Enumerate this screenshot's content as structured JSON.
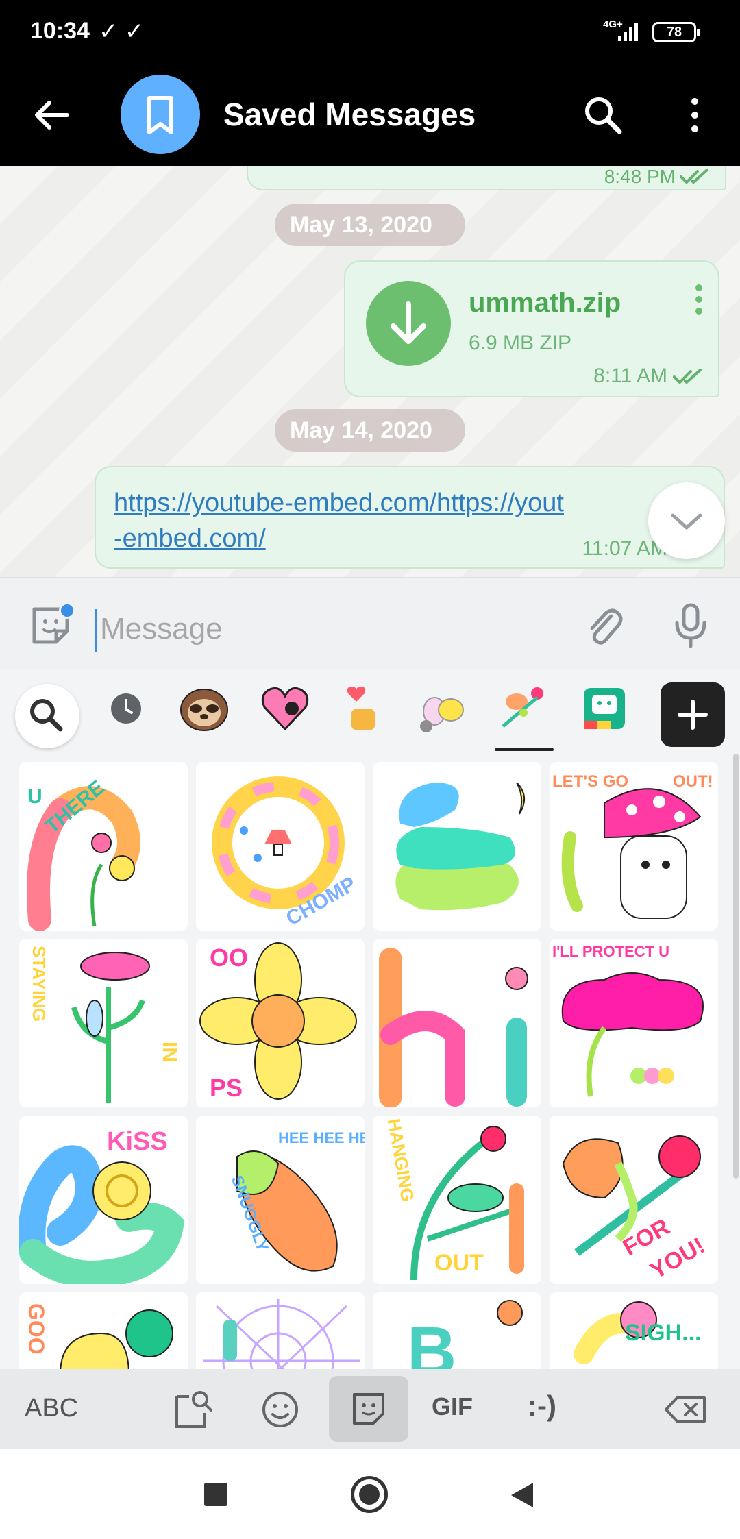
{
  "status_bar": {
    "time": "10:34",
    "checks": "✓ ✓",
    "network": "4G+",
    "battery": "78"
  },
  "header": {
    "title": "Saved Messages",
    "avatar_icon": "bookmark-icon",
    "back_icon": "arrow-back-icon",
    "search_icon": "search-icon",
    "more_icon": "more-vertical-icon",
    "background": "#000000",
    "avatar_color": "#5fb1ff"
  },
  "chat": {
    "previous_message_time": "8:48 PM",
    "date_1": "May 13, 2020",
    "file_message": {
      "name": "ummath.zip",
      "size": "6.9 MB ZIP",
      "time": "8:11 AM",
      "icon": "download-icon"
    },
    "date_2": "May 14, 2020",
    "link_message": {
      "text": "https://youtube-embed.com/https://yout\n-embed.com/",
      "time": "11:07 AM"
    },
    "bubble_color": "#e6f6ea",
    "accent_green": "#4aa854",
    "link_color": "#2f7cc1"
  },
  "input": {
    "placeholder": "Message",
    "value": "",
    "sticker_icon": "sticker-icon",
    "attach_icon": "paperclip-icon",
    "mic_icon": "microphone-icon"
  },
  "sticker_panel": {
    "tabs": [
      "search-icon",
      "recent-clock-icon",
      "sloth-sticker-pack",
      "heart-sticker-pack",
      "hand-heart-sticker-pack",
      "bunny-cat-sticker-pack",
      "flower-caterpillar-sticker-pack",
      "face-sticker-pack"
    ],
    "active_tab": "flower-caterpillar-sticker-pack",
    "add_icon": "plus-icon",
    "stickers": [
      {
        "name": "sticker-u-there",
        "text_1": "U",
        "text_2": "THERE"
      },
      {
        "name": "sticker-chomp",
        "text_1": "CHOMP"
      },
      {
        "name": "sticker-sleepy-worms"
      },
      {
        "name": "sticker-lets-go-out",
        "text_1": "LET'S GO",
        "text_2": "OUT!"
      },
      {
        "name": "sticker-staying-in",
        "text_1": "STAYING",
        "text_2": "IN"
      },
      {
        "name": "sticker-oops",
        "text_1": "OO",
        "text_2": "PS"
      },
      {
        "name": "sticker-hi",
        "text_1": "hi"
      },
      {
        "name": "sticker-ill-protect-u",
        "text_1": "I'LL PROTECT U"
      },
      {
        "name": "sticker-kiss",
        "text_1": "KiSS"
      },
      {
        "name": "sticker-snuggly",
        "text_1": "HEE HEE HEE",
        "text_2": "SNUGGLY"
      },
      {
        "name": "sticker-hanging-out",
        "text_1": "HANGING",
        "text_2": "OUT"
      },
      {
        "name": "sticker-for-you",
        "text_1": "FOR",
        "text_2": "YOU!"
      },
      {
        "name": "sticker-good",
        "text_1": "GOO"
      },
      {
        "name": "sticker-web"
      },
      {
        "name": "sticker-b",
        "text_1": "B"
      },
      {
        "name": "sticker-sigh",
        "text_1": "SIGH..."
      }
    ]
  },
  "keyboard_bar": {
    "abc": "ABC",
    "gif": "GIF",
    "emoticon": ":-)",
    "items": [
      "clipboard-search-icon",
      "emoji-icon",
      "sticker-icon",
      "backspace-icon"
    ]
  },
  "nav_bar": {
    "items": [
      "recent-apps-icon",
      "home-icon",
      "back-icon"
    ]
  }
}
